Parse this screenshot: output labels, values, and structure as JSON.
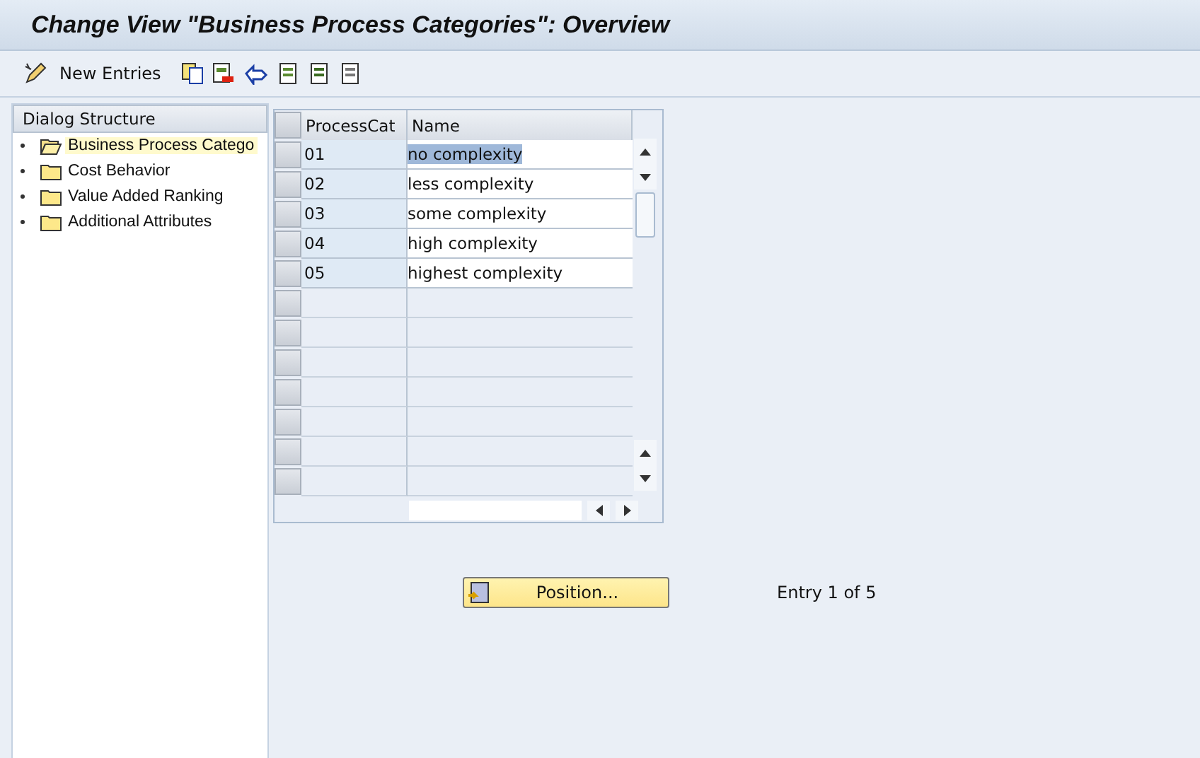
{
  "window": {
    "title": "Change View \"Business Process Categories\": Overview"
  },
  "toolbar": {
    "new_entries": "New Entries"
  },
  "dialog_structure": {
    "title": "Dialog Structure",
    "items": [
      {
        "label": "Business Process Catego",
        "selected": true
      },
      {
        "label": "Cost Behavior",
        "selected": false
      },
      {
        "label": "Value Added Ranking",
        "selected": false
      },
      {
        "label": "Additional Attributes",
        "selected": false
      }
    ]
  },
  "table": {
    "columns": [
      "ProcessCat",
      "Name"
    ],
    "rows": [
      {
        "cells": [
          "01",
          "no complexity"
        ],
        "selected": true
      },
      {
        "cells": [
          "02",
          "less complexity"
        ],
        "selected": false
      },
      {
        "cells": [
          "03",
          "some complexity"
        ],
        "selected": false
      },
      {
        "cells": [
          "04",
          "high complexity"
        ],
        "selected": false
      },
      {
        "cells": [
          "05",
          "highest complexity"
        ],
        "selected": false
      }
    ]
  },
  "position_button": "Position...",
  "entry_info": "Entry 1 of 5"
}
